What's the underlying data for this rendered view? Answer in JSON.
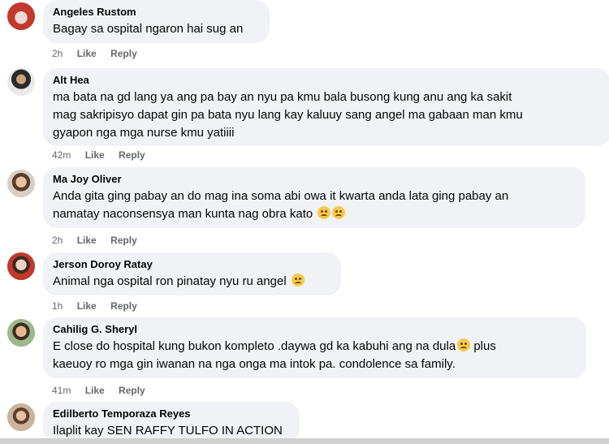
{
  "comments": [
    {
      "author": "Angeles Rustom",
      "lines": [
        "Bagay sa ospital ngaron hai sug an"
      ],
      "time": "2h",
      "like": "Like",
      "reply": "Reply"
    },
    {
      "author": "Alt Hea",
      "lines": [
        "ma bata na gd lang ya ang pa bay an nyu pa kmu bala busong kung anu ang ka sakit",
        "mag sakripisyo dapat gin pa bata nyu lang kay kaluuy sang angel ma gabaan man kmu",
        "gyapon nga mga nurse kmu yatiiii"
      ],
      "time": "42m",
      "like": "Like",
      "reply": "Reply"
    },
    {
      "author": "Ma Joy Oliver",
      "lines": [
        "Anda gita ging pabay an do mag ina soma abi owa it kwarta anda lata ging pabay an",
        "namatay naconsensya man kunta nag obra kato"
      ],
      "time": "2h",
      "like": "Like",
      "reply": "Reply"
    },
    {
      "author": "Jerson Doroy Ratay",
      "lines": [
        "Animal nga ospital ron pinatay nyu ru angel"
      ],
      "time": "1h",
      "like": "Like",
      "reply": "Reply"
    },
    {
      "author": "Cahilig G. Sheryl",
      "lines": [
        "E close do hospital kung bukon kompleto .daywa gd ka kabuhi ang na dula",
        "plus",
        "kaeuoy ro mga gin iwanan na nga onga ma intok pa. condolence sa family."
      ],
      "time": "41m",
      "like": "Like",
      "reply": "Reply"
    },
    {
      "author": "Edilberto Temporaza Reyes",
      "lines": [
        "Ilaplit kay SEN RAFFY TULFO IN ACTION"
      ]
    }
  ],
  "colors": {
    "bubble": "#f0f2f5",
    "meta": "#65676b",
    "text": "#050505"
  }
}
